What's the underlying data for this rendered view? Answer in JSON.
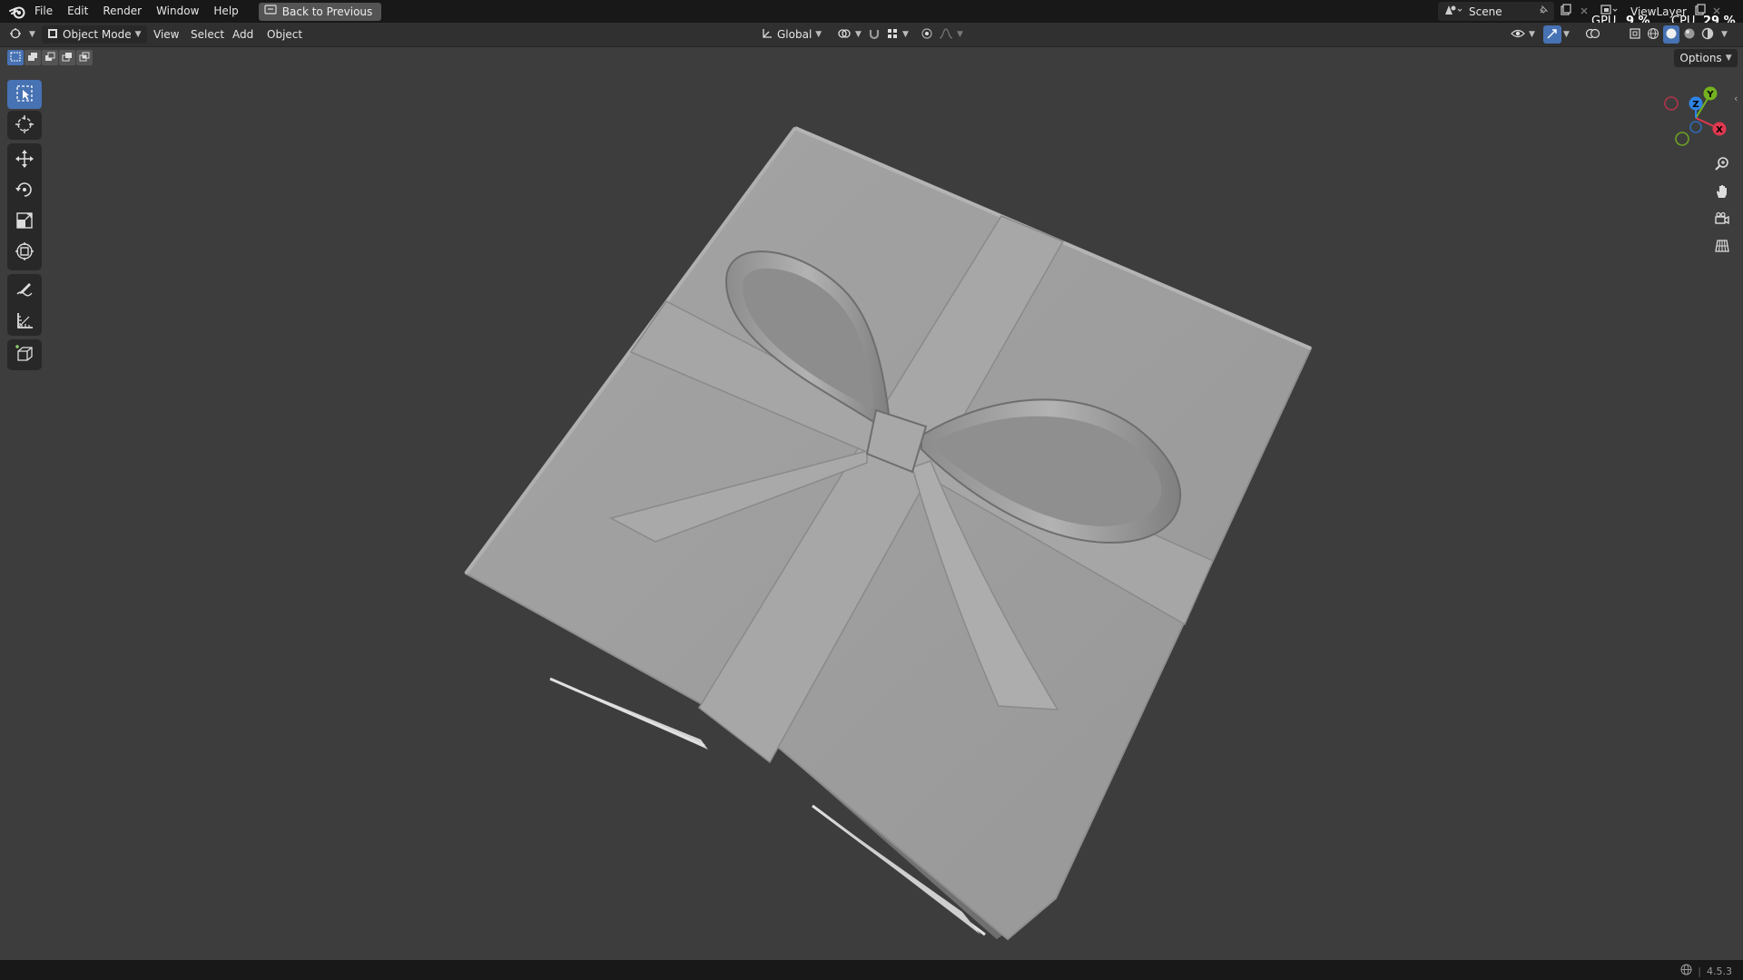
{
  "menubar": {
    "items": [
      {
        "label": "File"
      },
      {
        "label": "Edit"
      },
      {
        "label": "Render"
      },
      {
        "label": "Window"
      },
      {
        "label": "Help"
      }
    ],
    "back_button": "Back to Previous",
    "scene": "Scene",
    "view_layer": "ViewLayer",
    "gpu_label": "GPU",
    "gpu_value": "9 %",
    "cpu_label": "CPU",
    "cpu_value": "29 %"
  },
  "header": {
    "mode": "Object Mode",
    "menus": [
      "View",
      "Select",
      "Add",
      "Object"
    ],
    "orientation": "Global"
  },
  "toolbar": {
    "tools": [
      "select-box",
      "cursor",
      "move",
      "rotate",
      "scale",
      "transform",
      "annotate",
      "measure",
      "add-cube"
    ],
    "active_tool": "select-box"
  },
  "viewport": {
    "options_label": "Options",
    "gizmo_axes": {
      "x": "X",
      "y": "Y",
      "z": "Z"
    },
    "object": "gift box with ribbon bow"
  },
  "statusbar": {
    "version": "4.5.3"
  },
  "colors": {
    "accent": "#4772b3",
    "axis_x": "#e0384f",
    "axis_y": "#74b21f",
    "axis_z": "#2f83e6"
  }
}
